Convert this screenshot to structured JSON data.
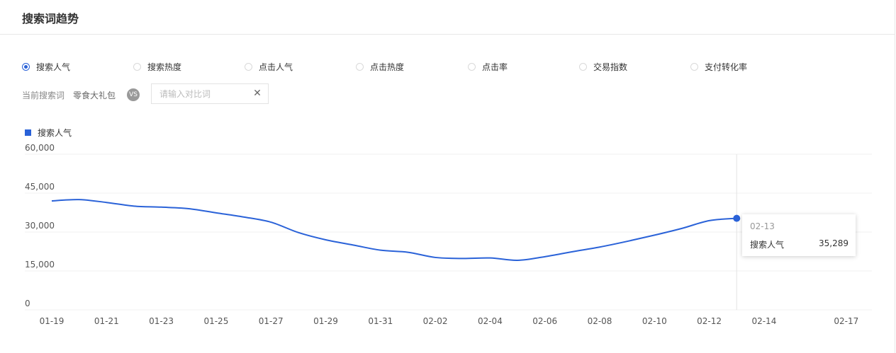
{
  "header": {
    "title": "搜索词趋势"
  },
  "metrics": [
    {
      "label": "搜索人气",
      "selected": true
    },
    {
      "label": "搜索热度",
      "selected": false
    },
    {
      "label": "点击人气",
      "selected": false
    },
    {
      "label": "点击热度",
      "selected": false
    },
    {
      "label": "点击率",
      "selected": false
    },
    {
      "label": "交易指数",
      "selected": false
    },
    {
      "label": "支付转化率",
      "selected": false
    }
  ],
  "compare": {
    "current_label": "当前搜索词",
    "current_term": "零食大礼包",
    "vs_label": "VS",
    "input_placeholder": "请输入对比词",
    "input_value": ""
  },
  "icons": {
    "clear": "close-icon",
    "radio": "radio-icon"
  },
  "colors": {
    "accent": "#2a62d8",
    "grid": "#f0f0f0",
    "crosshair": "#e4e4e4"
  },
  "chart_data": {
    "type": "line",
    "legend": [
      "搜索人气"
    ],
    "legend_position": "top-left",
    "grid": true,
    "x": [
      "01-19",
      "01-20",
      "01-21",
      "01-22",
      "01-23",
      "01-24",
      "01-25",
      "01-26",
      "01-27",
      "01-28",
      "01-29",
      "01-30",
      "01-31",
      "02-01",
      "02-02",
      "02-03",
      "02-04",
      "02-05",
      "02-06",
      "02-07",
      "02-08",
      "02-09",
      "02-10",
      "02-11",
      "02-12",
      "02-13"
    ],
    "x_ticks": [
      "01-19",
      "01-21",
      "01-23",
      "01-25",
      "01-27",
      "01-29",
      "01-31",
      "02-02",
      "02-04",
      "02-06",
      "02-08",
      "02-10",
      "02-12",
      "02-14",
      "02-17"
    ],
    "ylim": [
      0,
      60000
    ],
    "y_ticks": [
      0,
      15000,
      30000,
      45000,
      60000
    ],
    "y_tick_labels": [
      "0",
      "15,000",
      "30,000",
      "45,000",
      "60,000"
    ],
    "series": [
      {
        "name": "搜索人气",
        "values": [
          42000,
          42500,
          41400,
          40000,
          39600,
          39000,
          37400,
          35800,
          33800,
          29800,
          27000,
          25000,
          23000,
          22200,
          20200,
          19800,
          20000,
          19100,
          20500,
          22400,
          24200,
          26400,
          28800,
          31400,
          34400,
          35289
        ]
      }
    ],
    "tooltip": {
      "date": "02-13",
      "series": "搜索人气",
      "value": "35,289"
    }
  }
}
